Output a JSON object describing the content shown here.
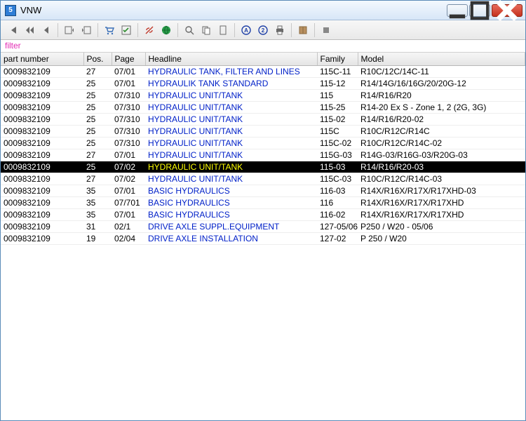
{
  "window": {
    "title": "VNW"
  },
  "filter_label": "filter",
  "columns": {
    "part_number": "part number",
    "pos": "Pos.",
    "page": "Page",
    "headline": "Headline",
    "family": "Family",
    "model": "Model"
  },
  "rows": [
    {
      "part": "0009832109",
      "pos": "27",
      "page": "07/01",
      "head": "HYDRAULIC TANK, FILTER AND LINES",
      "fam": "115C-11",
      "model": "R10C/12C/14C-11",
      "sel": false
    },
    {
      "part": "0009832109",
      "pos": "25",
      "page": "07/01",
      "head": "HYDRAULIK TANK STANDARD",
      "fam": "115-12",
      "model": "R14/14G/16/16G/20/20G-12",
      "sel": false
    },
    {
      "part": "0009832109",
      "pos": "25",
      "page": "07/310",
      "head": "HYDRAULIC UNIT/TANK",
      "fam": "115",
      "model": "R14/R16/R20",
      "sel": false
    },
    {
      "part": "0009832109",
      "pos": "25",
      "page": "07/310",
      "head": "HYDRAULIC UNIT/TANK",
      "fam": "115-25",
      "model": "R14-20 Ex S - Zone 1, 2 (2G, 3G)",
      "sel": false
    },
    {
      "part": "0009832109",
      "pos": "25",
      "page": "07/310",
      "head": "HYDRAULIC UNIT/TANK",
      "fam": "115-02",
      "model": "R14/R16/R20-02",
      "sel": false
    },
    {
      "part": "0009832109",
      "pos": "25",
      "page": "07/310",
      "head": "HYDRAULIC UNIT/TANK",
      "fam": "115C",
      "model": "R10C/R12C/R14C",
      "sel": false
    },
    {
      "part": "0009832109",
      "pos": "25",
      "page": "07/310",
      "head": "HYDRAULIC UNIT/TANK",
      "fam": "115C-02",
      "model": "R10C/R12C/R14C-02",
      "sel": false
    },
    {
      "part": "0009832109",
      "pos": "27",
      "page": "07/01",
      "head": "HYDRAULIC UNIT/TANK",
      "fam": "115G-03",
      "model": "R14G-03/R16G-03/R20G-03",
      "sel": false
    },
    {
      "part": "0009832109",
      "pos": "25",
      "page": "07/02",
      "head": "HYDRAULIC UNIT/TANK",
      "fam": "115-03",
      "model": "R14/R16/R20-03",
      "sel": true
    },
    {
      "part": "0009832109",
      "pos": "27",
      "page": "07/02",
      "head": "HYDRAULIC UNIT/TANK",
      "fam": "115C-03",
      "model": "R10C/R12C/R14C-03",
      "sel": false
    },
    {
      "part": "0009832109",
      "pos": "35",
      "page": "07/01",
      "head": "BASIC HYDRAULICS",
      "fam": "116-03",
      "model": "R14X/R16X/R17X/R17XHD-03",
      "sel": false
    },
    {
      "part": "0009832109",
      "pos": "35",
      "page": "07/701",
      "head": "BASIC HYDRAULICS",
      "fam": "116",
      "model": "R14X/R16X/R17X/R17XHD",
      "sel": false
    },
    {
      "part": "0009832109",
      "pos": "35",
      "page": "07/01",
      "head": "BASIC HYDRAULICS",
      "fam": "116-02",
      "model": "R14X/R16X/R17X/R17XHD",
      "sel": false
    },
    {
      "part": "0009832109",
      "pos": "31",
      "page": "02/1",
      "head": "DRIVE AXLE SUPPL.EQUIPMENT",
      "fam": "127-05/06",
      "model": "P250 / W20 - 05/06",
      "sel": false
    },
    {
      "part": "0009832109",
      "pos": "19",
      "page": "02/04",
      "head": "DRIVE AXLE INSTALLATION",
      "fam": "127-02",
      "model": "P 250 / W20",
      "sel": false
    }
  ]
}
